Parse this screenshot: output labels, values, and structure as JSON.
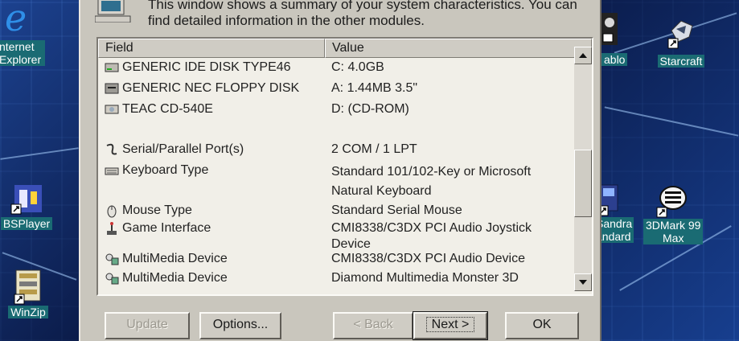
{
  "dialog": {
    "description": "This window shows a summary of your system characteristics. You can find detailed information in the other modules."
  },
  "list": {
    "columns": [
      "Field",
      "Value"
    ],
    "rows": [
      {
        "field": "GENERIC IDE  DISK TYPE46",
        "value": "C: 4.0GB",
        "icon": "hard-disk-icon"
      },
      {
        "field": "GENERIC NEC  FLOPPY DISK",
        "value": "A: 1.44MB 3.5\"",
        "icon": "floppy-drive-icon"
      },
      {
        "field": "TEAC CD-540E",
        "value": "D: (CD-ROM)",
        "icon": "cdrom-drive-icon"
      },
      {
        "field": "Serial/Parallel Port(s)",
        "value": "2 COM / 1 LPT",
        "icon": "port-icon"
      },
      {
        "field": "Keyboard Type",
        "value": "Standard 101/102-Key or Microsoft Natural Keyboard",
        "icon": "keyboard-icon"
      },
      {
        "field": "Mouse Type",
        "value": "Standard Serial Mouse",
        "icon": "mouse-icon"
      },
      {
        "field": "Game Interface",
        "value": "CMI8338/C3DX PCI Audio Joystick Device",
        "icon": "joystick-icon"
      },
      {
        "field": "MultiMedia Device",
        "value": "CMI8338/C3DX PCI Audio Device",
        "icon": "multimedia-icon"
      },
      {
        "field": "MultiMedia Device",
        "value": "Diamond Multimedia Monster 3D",
        "icon": "multimedia-icon"
      }
    ]
  },
  "buttons": {
    "update": "Update",
    "options": "Options...",
    "back": "< Back",
    "next": "Next >",
    "ok": "OK"
  },
  "desktop_icons": {
    "internet_explorer": "nternet\nExplorer",
    "bsplayer": "BSPlayer",
    "winzip": "WinZip",
    "diablo": "ablo",
    "starcraft": "Starcraft",
    "sandra": "Sandra\nandard",
    "threedmark": "3DMark 99\nMax"
  }
}
